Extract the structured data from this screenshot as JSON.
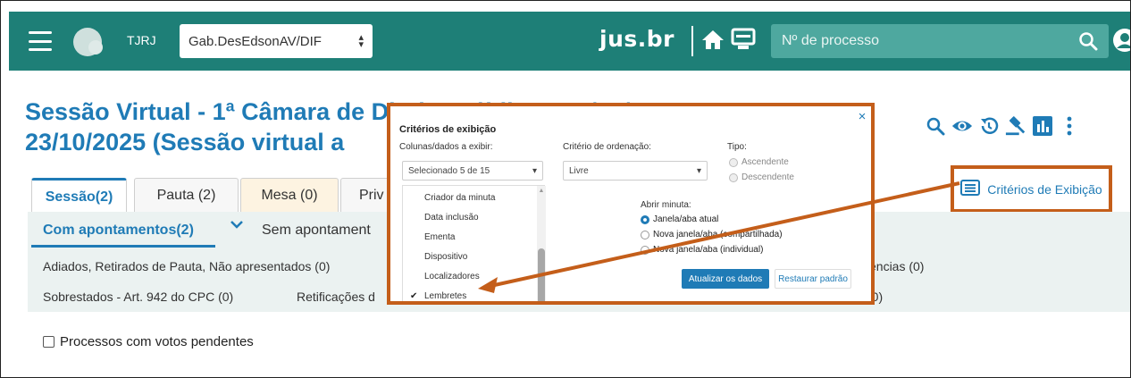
{
  "topbar": {
    "org": "TJRJ",
    "unit_selected": "Gab.DesEdsonAV/DIF",
    "brand": "jus.br",
    "search_placeholder": "Nº de processo"
  },
  "page": {
    "title": "Sessão Virtual - 1ª Câmara de Direito Público - 21/10/2025 A 23/10/2025 (Sessão virtual a"
  },
  "tabs": [
    {
      "label": "Sessão(2)"
    },
    {
      "label": "Pauta (2)"
    },
    {
      "label": "Mesa (0)"
    },
    {
      "label": "Priv"
    }
  ],
  "subtabs": {
    "com": "Com apontamentos(2)",
    "sem": "Sem apontament"
  },
  "filters": {
    "line1": "Adiados, Retirados de Pauta, Não apresentados (0)",
    "line1_right": "ências (0)",
    "line2": "Sobrestados - Art. 942 do CPC (0)",
    "line2_mid": "Retificações d",
    "line2_right": "(0)"
  },
  "pending_checkbox": "Processos com votos pendentes",
  "criterios_button": "Critérios de Exibição",
  "popup": {
    "title": "Critérios de exibição",
    "close": "×",
    "cols_label": "Colunas/dados a exibir:",
    "cols_selected": "Selecionado 5 de 15",
    "items": [
      "Criador da minuta",
      "Data inclusão",
      "Ementa",
      "Dispositivo",
      "Localizadores",
      "Lembretes"
    ],
    "checked_item": "Lembretes",
    "order_label": "Critério de ordenação:",
    "order_value": "Livre",
    "tipo_label": "Tipo:",
    "tipo_asc": "Ascendente",
    "tipo_desc": "Descendente",
    "abrir_label": "Abrir minuta:",
    "abrir_atual": "Janela/aba atual",
    "abrir_comp": "Nova janela/aba (compartilhada)",
    "abrir_ind": "Nova janela/aba (individual)",
    "btn_atualizar": "Atualizar os dados",
    "btn_restaurar": "Restaurar padrão"
  },
  "colors": {
    "header": "#1e7f77",
    "accent": "#1f7bb6",
    "highlight": "#c45e1a",
    "band": "#ebf2f1"
  }
}
